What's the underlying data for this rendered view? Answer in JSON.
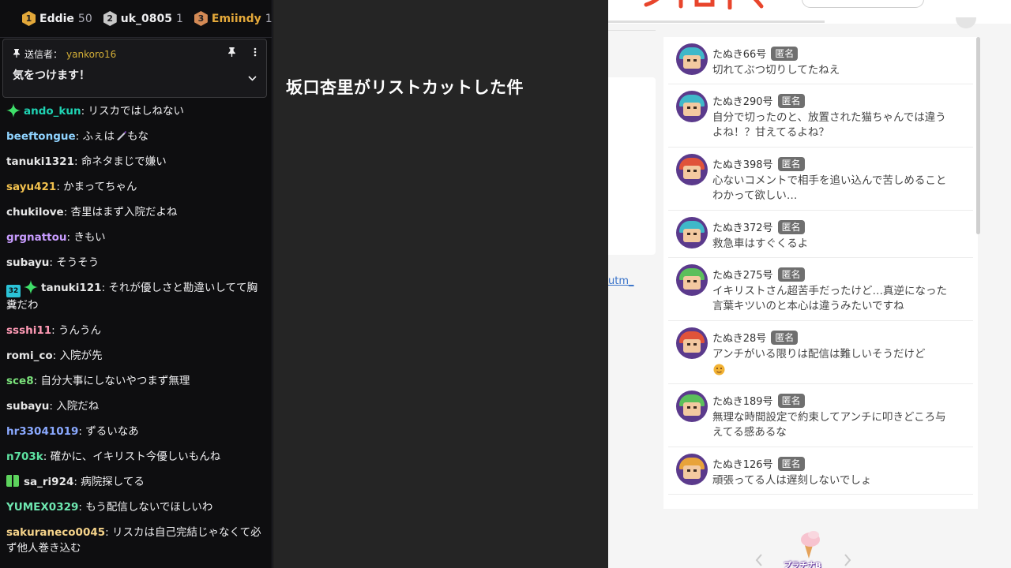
{
  "leaderboard": [
    {
      "rank": "1",
      "name": "Eddie",
      "count": "50",
      "color": "#e3a83a"
    },
    {
      "rank": "2",
      "name": "uk_0805",
      "count": "1",
      "color": "#c8c8c8"
    },
    {
      "rank": "3",
      "name": "Emiindy",
      "count": "1",
      "color": "#d48a55"
    }
  ],
  "pinned": {
    "sender_label": "送信者：",
    "sender": "yankoro16",
    "text": "気をつけます！"
  },
  "messages": [
    {
      "user": "ando_kun",
      "text": "リスカではしねない",
      "color": "#1fd3b3",
      "badge": "sparkle"
    },
    {
      "user": "beeftongue",
      "text": "ふぇは",
      "text2": "もな",
      "color": "#8fd3ff",
      "emote": "knife"
    },
    {
      "user": "tanuki1321",
      "text": "命ネタまじで嫌い",
      "color": "#e6e6e6"
    },
    {
      "user": "sayu421",
      "text": "かまってちゃん",
      "color": "#f2c14e"
    },
    {
      "user": "chukilove",
      "text": "杏里はまず入院だよね",
      "color": "#e6e6e6"
    },
    {
      "user": "grgnattou",
      "text": "きもい",
      "color": "#c89cff"
    },
    {
      "user": "subayu",
      "text": "そうそう",
      "color": "#e6e6e6"
    },
    {
      "user": "tanuki121",
      "text": "それが優しさと勘違いしてて胸糞だわ",
      "color": "#e6e6e6",
      "badge": "sub-sparkle",
      "sub_months": "32"
    },
    {
      "user": "ssshi11",
      "text": "うんうん",
      "color": "#ff9ab5"
    },
    {
      "user": "romi_co",
      "text": "入院が先",
      "color": "#e6e6e6"
    },
    {
      "user": "sce8",
      "text": "自分大事にしないやつまず無理",
      "color": "#7be27b"
    },
    {
      "user": "subayu",
      "text": "入院だね",
      "color": "#e6e6e6"
    },
    {
      "user": "hr33041019",
      "text": "ずるいなあ",
      "color": "#8aa9ff"
    },
    {
      "user": "n703k",
      "text": "確かに、イキリスト今優しいもんね",
      "color": "#5de0a0"
    },
    {
      "user": "sa_ri924",
      "text": "病院探してる",
      "color": "#e6e6e6",
      "badge": "gift"
    },
    {
      "user": "YUMEX0329",
      "text": "もう配信しないでほしいわ",
      "color": "#6ee7b0"
    },
    {
      "user": "sakuraneco0045",
      "text": "リスカは自己完結じゃなくて必ず他人巻き込む",
      "color": "#f5d38a"
    }
  ],
  "center": {
    "title": "坂口杏里がリストカットした件"
  },
  "web": {
    "link_fragment": "utm_",
    "tag_label": "匿名",
    "comments": [
      {
        "name": "たぬき66号",
        "text": "切れてぶつ切りしてたねえ",
        "cap": "#3fb8c9"
      },
      {
        "name": "たぬき290号",
        "text": "自分で切ったのと、放置された猫ちゃんでは違うよね！？甘えてるよね？",
        "cap": "#3fb8c9"
      },
      {
        "name": "たぬき398号",
        "text": "心ないコメントで相手を追い込んで苦しめることわかって欲しい…",
        "cap": "#e0533a"
      },
      {
        "name": "たぬき372号",
        "text": "救急車はすぐくるよ",
        "cap": "#3fb8c9"
      },
      {
        "name": "たぬき275号",
        "text": "イキリストさん超苦手だったけど…真逆になった　言葉キツいのと本心は違うみたいですね",
        "cap": "#5bbf5b"
      },
      {
        "name": "たぬき28号",
        "text": "アンチがいる限りは配信は難しいそうだけど",
        "cap": "#e0533a",
        "emoji": true
      },
      {
        "name": "たぬき189号",
        "text": "無理な時間設定で約束してアンチに叩きどころ与えてる感あるな",
        "cap": "#5bbf5b"
      },
      {
        "name": "たぬき126号",
        "text": "頑張ってる人は遅刻しないでしょ",
        "cap": "#e8a33a"
      }
    ],
    "bottom_label": "プラチナB"
  }
}
